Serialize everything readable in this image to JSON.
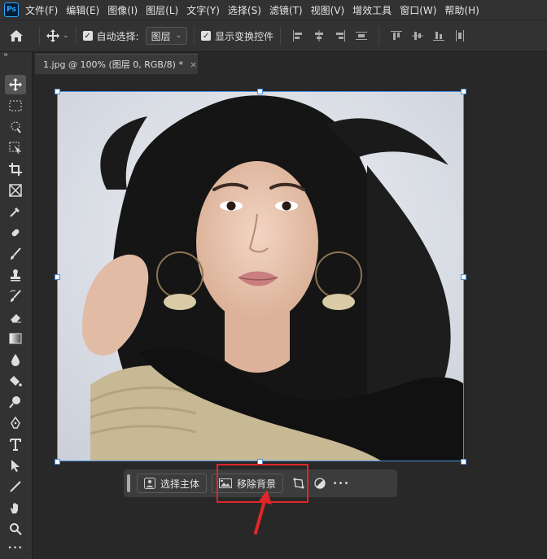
{
  "app": {
    "logo": "Ps"
  },
  "menu": [
    "文件(F)",
    "编辑(E)",
    "图像(I)",
    "图层(L)",
    "文字(Y)",
    "选择(S)",
    "滤镜(T)",
    "视图(V)",
    "增效工具",
    "窗口(W)",
    "帮助(H)"
  ],
  "options": {
    "auto_select_label": "自动选择:",
    "layer_dropdown": "图层",
    "show_transform_label": "显示变换控件",
    "checkmark": "✓"
  },
  "tab": {
    "title": "1.jpg @ 100% (图层 0, RGB/8) *",
    "close": "×"
  },
  "toolbar": {
    "collapse": "»"
  },
  "context_bar": {
    "select_subject": "选择主体",
    "remove_background": "移除背景",
    "more": "•••"
  },
  "colors": {
    "highlight": "#e0262a",
    "selection": "#4a90e2"
  }
}
